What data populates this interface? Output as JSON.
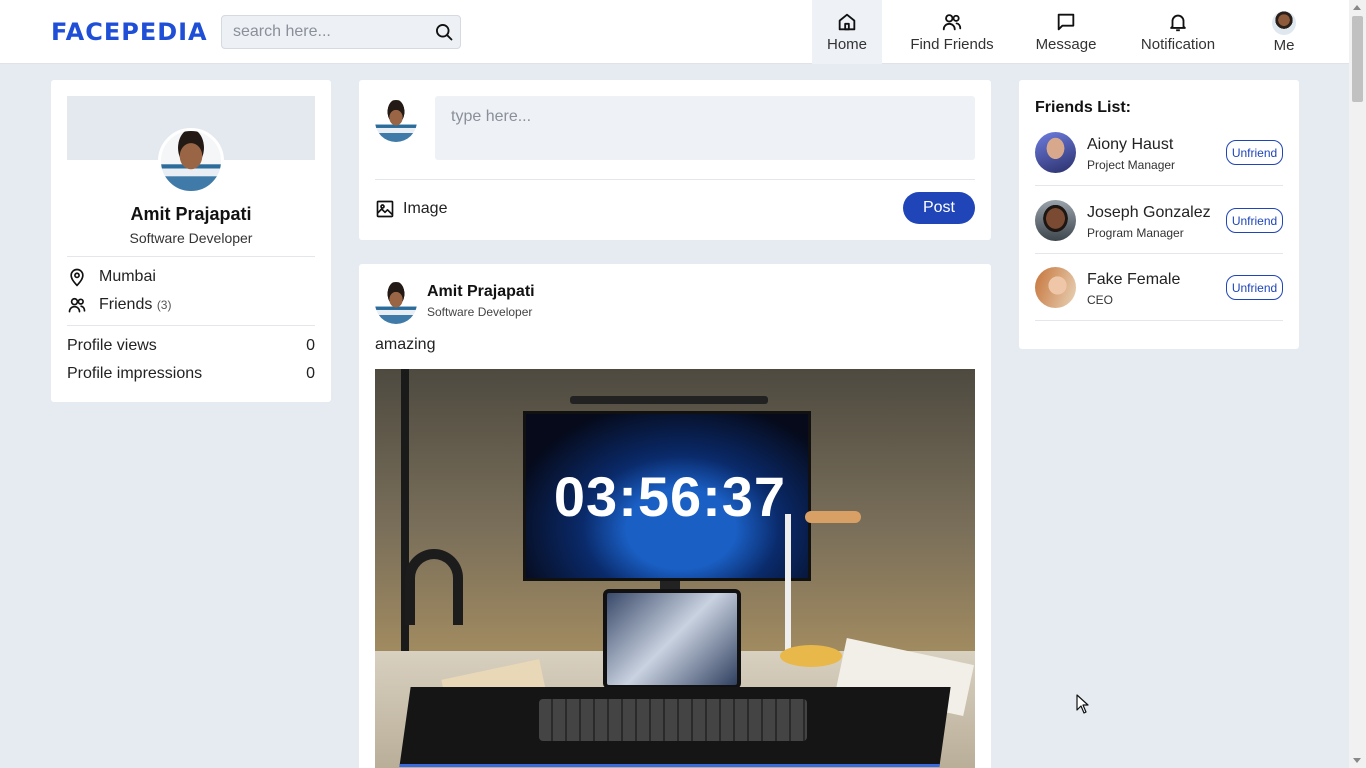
{
  "header": {
    "logo": "FACEPEDIA",
    "search_placeholder": "search here...",
    "nav": [
      {
        "label": "Home",
        "icon": "home-icon",
        "active": true
      },
      {
        "label": "Find Friends",
        "icon": "users-icon"
      },
      {
        "label": "Message",
        "icon": "message-icon"
      },
      {
        "label": "Notification",
        "icon": "bell-icon"
      },
      {
        "label": "Me",
        "icon": "avatar"
      }
    ]
  },
  "profile": {
    "name": "Amit Prajapati",
    "role": "Software Developer",
    "location": "Mumbai",
    "friends_label": "Friends",
    "friends_count": "(3)",
    "stats": [
      {
        "label": "Profile views",
        "value": "0"
      },
      {
        "label": "Profile impressions",
        "value": "0"
      }
    ]
  },
  "composer": {
    "placeholder": "type here...",
    "image_label": "Image",
    "post_label": "Post"
  },
  "post": {
    "author": "Amit Prajapati",
    "role": "Software Developer",
    "text": "amazing",
    "image_clock": "03:56:37"
  },
  "friends_list": {
    "title": "Friends List:",
    "items": [
      {
        "name": "Aiony Haust",
        "role": "Project Manager",
        "action": "Unfriend"
      },
      {
        "name": "Joseph Gonzalez",
        "role": "Program Manager",
        "action": "Unfriend"
      },
      {
        "name": "Fake Female",
        "role": "CEO",
        "action": "Unfriend"
      }
    ]
  },
  "colors": {
    "brand": "#1f4fd6",
    "primary_button": "#1f45b8",
    "background": "#e6ebf2"
  }
}
